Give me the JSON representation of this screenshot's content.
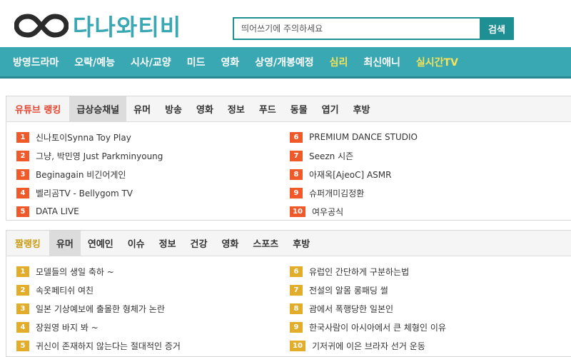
{
  "header": {
    "logo_text": "다나와티비",
    "search_placeholder": "띄어쓰기에 주의하세요",
    "search_button": "검색"
  },
  "nav": {
    "items": [
      {
        "label": "방영드라마",
        "highlight": false
      },
      {
        "label": "오락/예능",
        "highlight": false
      },
      {
        "label": "시사/교양",
        "highlight": false
      },
      {
        "label": "미드",
        "highlight": false
      },
      {
        "label": "영화",
        "highlight": false
      },
      {
        "label": "상영/개봉예정",
        "highlight": false
      },
      {
        "label": "심리",
        "highlight": true
      },
      {
        "label": "최신애니",
        "highlight": false
      },
      {
        "label": "실시간TV",
        "highlight": true
      }
    ]
  },
  "youtube": {
    "title": "유튜브 랭킹",
    "tabs": [
      "급상승채널",
      "유머",
      "방송",
      "영화",
      "정보",
      "푸드",
      "동물",
      "엽기",
      "후방"
    ],
    "active_tab": 0,
    "items": [
      {
        "rank": "1",
        "text": "신나토이Synna Toy Play"
      },
      {
        "rank": "2",
        "text": "그냥, 박민영 Just Parkminyoung"
      },
      {
        "rank": "3",
        "text": "Beginagain 비긴어게인"
      },
      {
        "rank": "4",
        "text": "벨리곰TV - Bellygom TV"
      },
      {
        "rank": "5",
        "text": "DATA LIVE"
      },
      {
        "rank": "6",
        "text": "PREMIUM DANCE STUDIO"
      },
      {
        "rank": "7",
        "text": "Seezn 시즌"
      },
      {
        "rank": "8",
        "text": "아재옥[AjeoC] ASMR"
      },
      {
        "rank": "9",
        "text": "슈퍼개미김정환"
      },
      {
        "rank": "10",
        "text": "여우공식"
      }
    ]
  },
  "short": {
    "title": "짤랭킹",
    "tabs": [
      "유머",
      "연예인",
      "이슈",
      "정보",
      "건강",
      "영화",
      "스포츠",
      "후방"
    ],
    "active_tab": 0,
    "items": [
      {
        "rank": "1",
        "text": "모델들의 생일 축하 ~"
      },
      {
        "rank": "2",
        "text": "속옷페티쉬 여친"
      },
      {
        "rank": "3",
        "text": "일본 기상예보에 출몰한 형체가 논란"
      },
      {
        "rank": "4",
        "text": "장원영 바지 봐 ~"
      },
      {
        "rank": "5",
        "text": "귀신이 존재하지 않는다는 절대적인 증거"
      },
      {
        "rank": "6",
        "text": "유럽인 간단하게 구분하는법"
      },
      {
        "rank": "7",
        "text": "전설의 알몸 롱패딩 썰"
      },
      {
        "rank": "8",
        "text": "괌에서 폭행당한 일본인"
      },
      {
        "rank": "9",
        "text": "한국사람이 아시아에서 큰 체형인 이유"
      },
      {
        "rank": "10",
        "text": "기저귀에 이은 브라자 선거 운동"
      }
    ]
  },
  "colors": {
    "brand": "#3aa8b2",
    "search_border": "#1e8f93",
    "nav_highlight": "#f5e25a",
    "rank_red": "#f05a2a",
    "rank_gold": "#e2ad2a",
    "title_red": "#e4452f",
    "title_gold": "#c99c13"
  }
}
